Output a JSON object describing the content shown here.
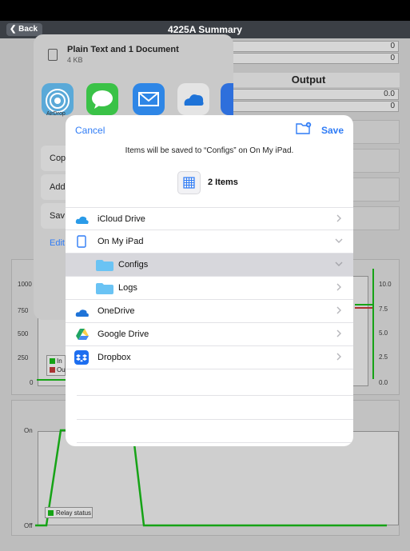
{
  "nav": {
    "back_label": "Back",
    "title": "4225A Summary"
  },
  "background": {
    "values_top": [
      "0",
      "0"
    ],
    "output_header": "Output",
    "values_output": [
      "0.0",
      "0"
    ],
    "chart1": {
      "left_ticks": [
        "1000",
        "750",
        "500",
        "250",
        "0"
      ],
      "right_ticks": [
        "10.0",
        "7.5",
        "5.0",
        "2.5",
        "0.0"
      ],
      "legend": [
        "In",
        "Ou"
      ]
    },
    "chart2": {
      "left_ticks": [
        "On",
        "Off"
      ],
      "legend": "Relay status"
    }
  },
  "share": {
    "title": "Plain Text and 1 Document",
    "subtitle": "4 KB",
    "airdrop_label": "AirDrop",
    "actions": [
      "Cop",
      "Add",
      "Sav"
    ],
    "edit_label": "Edit"
  },
  "dialog": {
    "cancel": "Cancel",
    "save": "Save",
    "note": "Items will be saved to “Configs” on On My iPad.",
    "items_count": "2 Items",
    "locations": [
      {
        "label": "iCloud Drive",
        "icon": "icloud-icon",
        "expanded": false
      },
      {
        "label": "On My iPad",
        "icon": "ipad-icon",
        "expanded": true
      },
      {
        "label": "Configs",
        "icon": "folder-icon",
        "expanded": true,
        "selected": true
      },
      {
        "label": "Logs",
        "icon": "folder-icon",
        "expanded": false
      },
      {
        "label": "OneDrive",
        "icon": "onedrive-icon",
        "expanded": false
      },
      {
        "label": "Google Drive",
        "icon": "google-drive-icon",
        "expanded": false
      },
      {
        "label": "Dropbox",
        "icon": "dropbox-icon",
        "expanded": false
      }
    ]
  },
  "colors": {
    "accent": "#2f7cf6",
    "folder": "#6ac3f4",
    "chart_green": "#16a316"
  }
}
